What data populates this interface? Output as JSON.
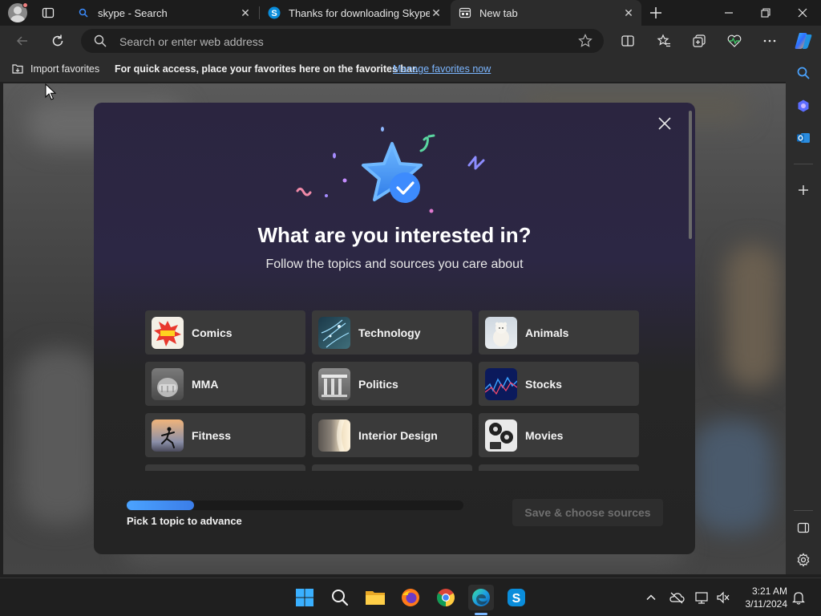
{
  "browser": {
    "tabs": [
      {
        "label": "skype - Search",
        "icon": "search-icon"
      },
      {
        "label": "Thanks for downloading Skype",
        "icon": "skype-icon"
      },
      {
        "label": "New tab",
        "icon": "new-tab-icon",
        "active": true
      }
    ],
    "address": {
      "placeholder": "Search or enter web address"
    },
    "favorites_bar": {
      "import_label": "Import favorites",
      "message": "For quick access, place your favorites here on the favorites bar.",
      "manage_link": "Manage favorites now"
    }
  },
  "modal": {
    "title": "What are you interested in?",
    "subtitle": "Follow the topics and sources you care about",
    "topics": [
      {
        "label": "Comics",
        "icon": "comics-thumbnail"
      },
      {
        "label": "Technology",
        "icon": "technology-thumbnail"
      },
      {
        "label": "Animals",
        "icon": "animals-thumbnail"
      },
      {
        "label": "MMA",
        "icon": "mma-thumbnail"
      },
      {
        "label": "Politics",
        "icon": "politics-thumbnail"
      },
      {
        "label": "Stocks",
        "icon": "stocks-thumbnail"
      },
      {
        "label": "Fitness",
        "icon": "fitness-thumbnail"
      },
      {
        "label": "Interior Design",
        "icon": "interior-design-thumbnail"
      },
      {
        "label": "Movies",
        "icon": "movies-thumbnail"
      }
    ],
    "progress": {
      "fraction": 0.2,
      "label": "Pick 1 topic to advance"
    },
    "save_button": "Save & choose sources"
  },
  "taskbar": {
    "apps": [
      "windows-start-icon",
      "search-icon",
      "file-explorer-icon",
      "firefox-icon",
      "chrome-icon",
      "edge-icon",
      "skype-icon"
    ],
    "clock": {
      "time": "3:21 AM",
      "date": "3/11/2024"
    }
  },
  "colors": {
    "accent": "#4ba3ff",
    "link": "#7cb6ff",
    "modal_top": "#2b2540",
    "card": "#3a3a3a"
  }
}
